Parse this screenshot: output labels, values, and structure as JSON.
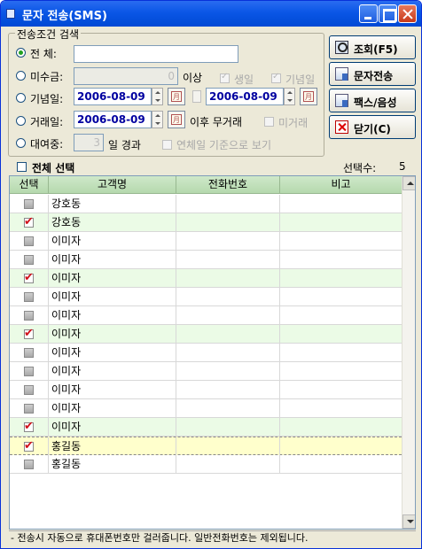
{
  "window": {
    "title": "문자 전송(SMS)"
  },
  "search_group": {
    "legend": "전송조건 검색",
    "all_label": "전 체:",
    "all_value": "",
    "unpaid_label": "미수금:",
    "unpaid_value": "0",
    "unpaid_suffix": "이상",
    "birthday_label": "생일",
    "anniversary_label": "기념일",
    "anniv_date_label": "기념일:",
    "anniv_from": "2006-08-09",
    "anniv_to": "2006-08-09",
    "trade_label": "거래일:",
    "trade_date": "2006-08-09",
    "trade_suffix": "이후 무거래",
    "no_trade_label": "미거래",
    "rental_label": "대여중:",
    "rental_days": "3",
    "rental_suffix": "일 경과",
    "overdue_label": "연체일 기준으로 보기",
    "calendar_glyph": "月"
  },
  "buttons": {
    "search": "조회(F5)",
    "send_sms": "문자전송",
    "fax": "팩스/음성",
    "close": "닫기(C)"
  },
  "select_all_label": "전체 선택",
  "selected_count_label": "선택수:",
  "selected_count": "5",
  "grid": {
    "columns": [
      "선택",
      "고객명",
      "전화번호",
      "비고"
    ],
    "rows": [
      {
        "name": "강호동",
        "checked": false
      },
      {
        "name": "강호동",
        "checked": true
      },
      {
        "name": "이미자",
        "checked": false
      },
      {
        "name": "이미자",
        "checked": false
      },
      {
        "name": "이미자",
        "checked": true
      },
      {
        "name": "이미자",
        "checked": false
      },
      {
        "name": "이미자",
        "checked": false
      },
      {
        "name": "이미자",
        "checked": true
      },
      {
        "name": "이미자",
        "checked": false
      },
      {
        "name": "이미자",
        "checked": false
      },
      {
        "name": "이미자",
        "checked": false
      },
      {
        "name": "이미자",
        "checked": false
      },
      {
        "name": "이미자",
        "checked": true
      },
      {
        "name": "홍길동",
        "checked": true
      },
      {
        "name": "홍길동",
        "checked": false
      }
    ]
  },
  "footer": "- 전송시 자동으로 휴대폰번호만 걸러줍니다. 일반전화번호는 제외됩니다."
}
